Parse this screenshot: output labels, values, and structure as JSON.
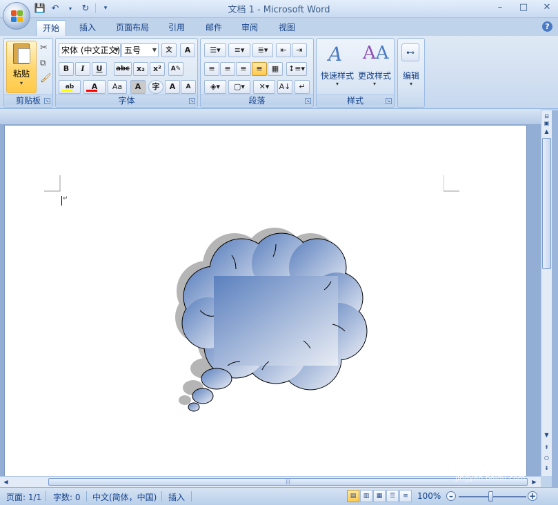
{
  "window": {
    "title": "文档 1 - Microsoft Word",
    "controls": {
      "minimize": "–",
      "maximize": "□",
      "close": "✕"
    }
  },
  "quick_access": [
    "save-icon",
    "undo-icon",
    "redo-icon",
    "customize-icon"
  ],
  "tabs": [
    {
      "label": "开始",
      "active": true
    },
    {
      "label": "插入"
    },
    {
      "label": "页面布局"
    },
    {
      "label": "引用"
    },
    {
      "label": "邮件"
    },
    {
      "label": "审阅"
    },
    {
      "label": "视图"
    }
  ],
  "ribbon": {
    "clipboard": {
      "label": "剪贴板",
      "paste": "粘贴"
    },
    "font": {
      "label": "字体",
      "font_name": "宋体 (中文正文)",
      "font_size": "五号",
      "bold": "B",
      "italic": "I",
      "underline": "U",
      "strike": "abc",
      "subscript": "x₂",
      "superscript": "x²",
      "grow": "A",
      "shrink": "A",
      "case": "Aa"
    },
    "paragraph": {
      "label": "段落"
    },
    "styles": {
      "label": "样式",
      "quick_styles": "快速样式",
      "change_styles": "更改样式"
    },
    "editing": {
      "label": "编辑"
    }
  },
  "document": {
    "para_mark": "↵"
  },
  "status": {
    "page": "页面: 1/1",
    "words": "字数: 0",
    "language": "中文(简体，中国)",
    "mode": "插入",
    "zoom": "100%",
    "zoom_minus": "–",
    "zoom_plus": "+"
  },
  "watermark": {
    "text": "Bai 经验",
    "sub": "jingyan.baidu.com"
  },
  "colors": {
    "highlight": "#ffff00",
    "font_color": "#ff0000",
    "cloud_top": "#5b80be",
    "cloud_bottom": "#e8ecf4"
  }
}
